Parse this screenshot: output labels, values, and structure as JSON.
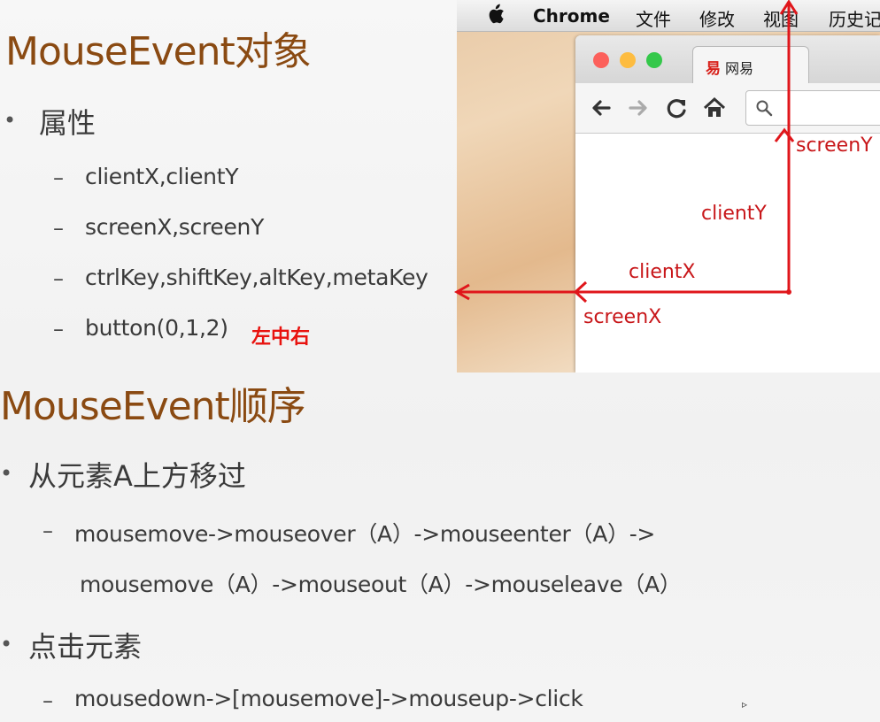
{
  "section1": {
    "title": "MouseEvent对象",
    "bullet": "属性",
    "items": [
      "clientX,clientY",
      "screenX,screenY",
      "ctrlKey,shiftKey,altKey,metaKey",
      "button(0,1,2)"
    ],
    "button_note": "左中右"
  },
  "section2": {
    "title": "MouseEvent顺序",
    "bullet1": "从元素A上方移过",
    "bullet1_line1": "mousemove->mouseover（A）->mouseenter（A）->",
    "bullet1_line2": "mousemove（A）->mouseout（A）->mouseleave（A）",
    "bullet2": "点击元素",
    "bullet2_line1": "mousedown->[mousemove]->mouseup->click"
  },
  "bullets": {
    "dot": "•",
    "dash": "–"
  },
  "screenshot": {
    "menu": [
      "Chrome",
      "文件",
      "修改",
      "视图",
      "历史记"
    ],
    "tab_label": "网易",
    "tab_icon_glyph": "易",
    "annotations": {
      "screenY": "screenY",
      "clientY": "clientY",
      "clientX": "clientX",
      "screenX": "screenX"
    },
    "traffic_colors": [
      "#fc605b",
      "#fdbc40",
      "#34c84a"
    ],
    "annotation_color": "#e0161b"
  },
  "colors": {
    "heading": "#8a4a12",
    "note": "#e8130f"
  }
}
